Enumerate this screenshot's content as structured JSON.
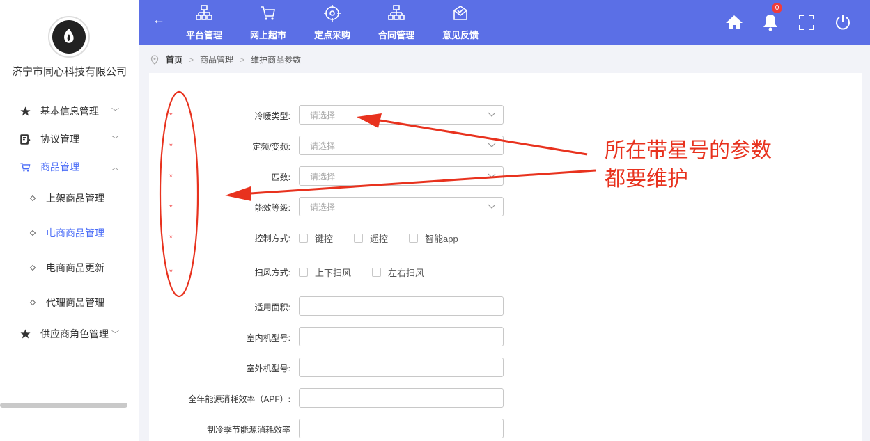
{
  "company": "济宁市同心科技有限公司",
  "sidebar": {
    "menus": [
      {
        "label": "基本信息管理",
        "chevron": "﹀"
      },
      {
        "label": "协议管理",
        "chevron": "﹀"
      },
      {
        "label": "商品管理",
        "chevron": "︿"
      },
      {
        "label": "供应商角色管理",
        "chevron": "﹀"
      }
    ],
    "sub_items": [
      {
        "label": "上架商品管理"
      },
      {
        "label": "电商商品管理"
      },
      {
        "label": "电商商品更新"
      },
      {
        "label": "代理商品管理"
      }
    ]
  },
  "topbar": {
    "back": "←",
    "nav": [
      {
        "label": "平台管理"
      },
      {
        "label": "网上超市"
      },
      {
        "label": "定点采购"
      },
      {
        "label": "合同管理"
      },
      {
        "label": "意见反馈"
      }
    ],
    "notification_count": "0"
  },
  "breadcrumb": {
    "home": "首页",
    "sep": ">",
    "level1": "商品管理",
    "level2": "维护商品参数"
  },
  "form": {
    "star": "*",
    "fields": [
      {
        "label": "冷暖类型:",
        "placeholder": "请选择"
      },
      {
        "label": "定频/变频:",
        "placeholder": "请选择"
      },
      {
        "label": "匹数:",
        "placeholder": "请选择"
      },
      {
        "label": "能效等级:",
        "placeholder": "请选择"
      }
    ],
    "control": {
      "label": "控制方式:",
      "options": [
        "键控",
        "遥控",
        "智能app"
      ]
    },
    "sweep": {
      "label": "扫风方式:",
      "options": [
        "上下扫风",
        "左右扫风"
      ]
    },
    "text_fields": [
      {
        "label": "适用面积:",
        "value": ""
      },
      {
        "label": "室内机型号:",
        "value": ""
      },
      {
        "label": "室外机型号:",
        "value": ""
      },
      {
        "label": "全年能源消耗效率（APF）:",
        "value": ""
      },
      {
        "label": "制冷季节能源消耗效率",
        "value": ""
      }
    ]
  },
  "annotation": {
    "line1": "所在带星号的参数",
    "line2": "都要维护"
  },
  "colors": {
    "topbar": "#5b6fe6",
    "active": "#4a6cf7",
    "annotation": "#e8321e",
    "required_star": "#f04040"
  }
}
